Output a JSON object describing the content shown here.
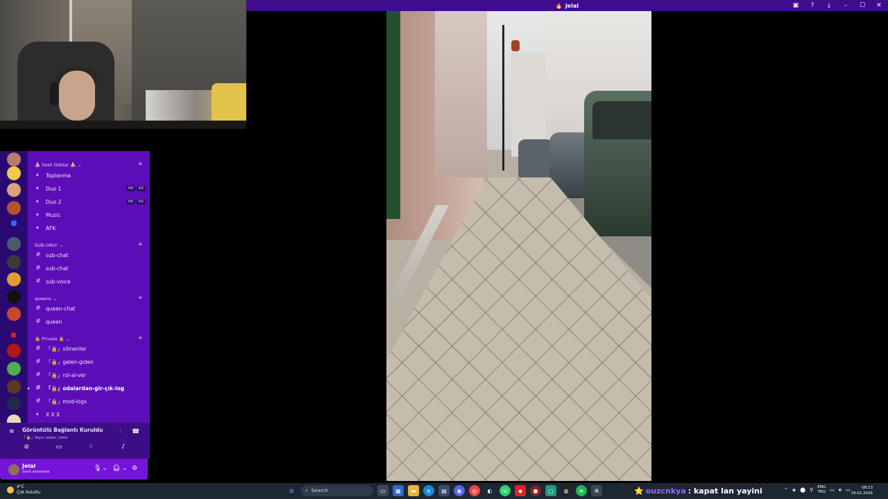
{
  "window": {
    "title": "Jelal"
  },
  "sidebar": {
    "categories": [
      {
        "label": "🍌 Sesli Odalar 🍌"
      },
      {
        "label": "SUB-ONLY"
      },
      {
        "label": "queens"
      },
      {
        "label": "🔒 Private 🔒"
      }
    ],
    "channels": [
      {
        "label": "Toplanma",
        "type": "voice"
      },
      {
        "label": "Duo 1",
        "type": "voice",
        "badges": [
          "00",
          "02"
        ]
      },
      {
        "label": "Duo 2",
        "type": "voice",
        "badges": [
          "00",
          "02"
        ]
      },
      {
        "label": "Music",
        "type": "voice"
      },
      {
        "label": "AFK",
        "type": "voice"
      },
      {
        "label": "sub-chat",
        "type": "text"
      },
      {
        "label": "sub-chat",
        "type": "text"
      },
      {
        "label": "sub-voice",
        "type": "text"
      },
      {
        "label": "queen-chat",
        "type": "text"
      },
      {
        "label": "queen",
        "type": "text"
      },
      {
        "label": "「🔒」silinenler",
        "type": "text"
      },
      {
        "label": "「🔒」gelen-giden",
        "type": "text"
      },
      {
        "label": "「🔒」rol-al-ver",
        "type": "text"
      },
      {
        "label": "「🔒」odalardan-gir-çık-log",
        "type": "text",
        "active": true
      },
      {
        "label": "「🔒」mod-logs",
        "type": "text"
      },
      {
        "label": "X X X",
        "type": "voice"
      }
    ]
  },
  "voice_panel": {
    "status": "Görüntülü Bağlantı Kuruldu",
    "sub": "「🔒」Yayın odası / Jelal"
  },
  "user_panel": {
    "name": "Jelal",
    "status": "Sesli aramada"
  },
  "taskbar": {
    "weather_temp": "4°C",
    "weather_desc": "Çok bulutlu",
    "search_placeholder": "Search",
    "lang_top": "ENG",
    "lang_bottom": "TRQ",
    "time": "08:13",
    "date": "19.02.2026"
  },
  "chat_overlay": {
    "user": "ouzcnkya",
    "message": ": kapat lan yayini"
  },
  "colors": {
    "titlebar": "#3d0d8e",
    "sidebar": "#5c0db8",
    "guild_bar": "#2a0a72",
    "user_panel": "#7414d8",
    "taskbar": "#1c2733",
    "chat_user": "#9b6bff"
  }
}
